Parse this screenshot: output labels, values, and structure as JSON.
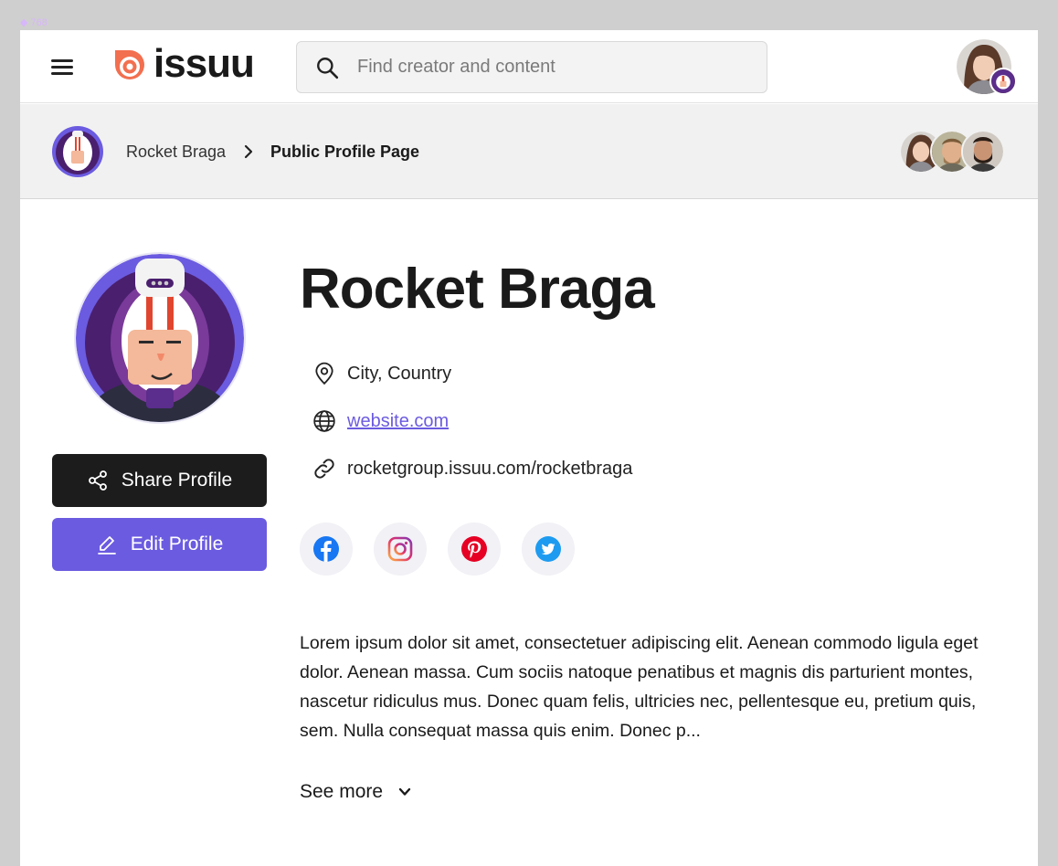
{
  "frame_label": "◆ 768",
  "header": {
    "logo_text": "issuu",
    "search_placeholder": "Find creator and content"
  },
  "breadcrumb": {
    "parent": "Rocket Braga",
    "current": "Public Profile Page"
  },
  "profile": {
    "name": "Rocket Braga",
    "location": "City, Country",
    "website": "website.com",
    "profile_url": "rocketgroup.issuu.com/rocketbraga",
    "share_label": "Share Profile",
    "edit_label": "Edit Profile",
    "bio": "Lorem ipsum dolor sit amet, consectetuer adipiscing elit. Aenean commodo ligula eget dolor. Aenean massa. Cum sociis natoque penatibus et magnis dis parturient montes, nascetur ridiculus mus. Donec quam felis, ultricies nec, pellentesque eu, pretium quis, sem. Nulla consequat massa quis enim. Donec p...",
    "see_more_label": "See more"
  },
  "socials": [
    {
      "icon": "facebook-icon",
      "color": "#1877f2"
    },
    {
      "icon": "instagram-icon",
      "color": "#e1306c"
    },
    {
      "icon": "pinterest-icon",
      "color": "#e60023"
    },
    {
      "icon": "twitter-icon",
      "color": "#1d9bf0"
    }
  ],
  "colors": {
    "accent": "#6b5be0",
    "brand": "#f26f4f",
    "dark_button": "#1c1c1c"
  }
}
